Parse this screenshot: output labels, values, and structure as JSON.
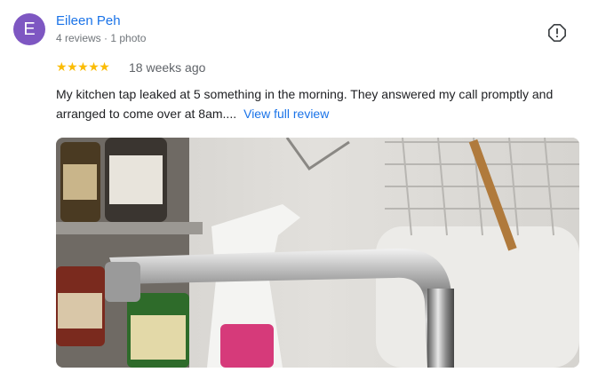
{
  "reviewer": {
    "initial": "E",
    "avatar_color": "#7e57c2",
    "name": "Eileen Peh",
    "stats": "4 reviews · 1 photo"
  },
  "rating": {
    "stars": 5,
    "max": 5,
    "star_color": "#fbbc04"
  },
  "time_ago": "18 weeks ago",
  "review_text": "My kitchen tap leaked at 5 something in the morning. They answered my call promptly and arranged to come over at 8am....",
  "view_full_review_label": "View full review",
  "report_icon": "report-flag-icon",
  "accent_color": "#1a73e8"
}
